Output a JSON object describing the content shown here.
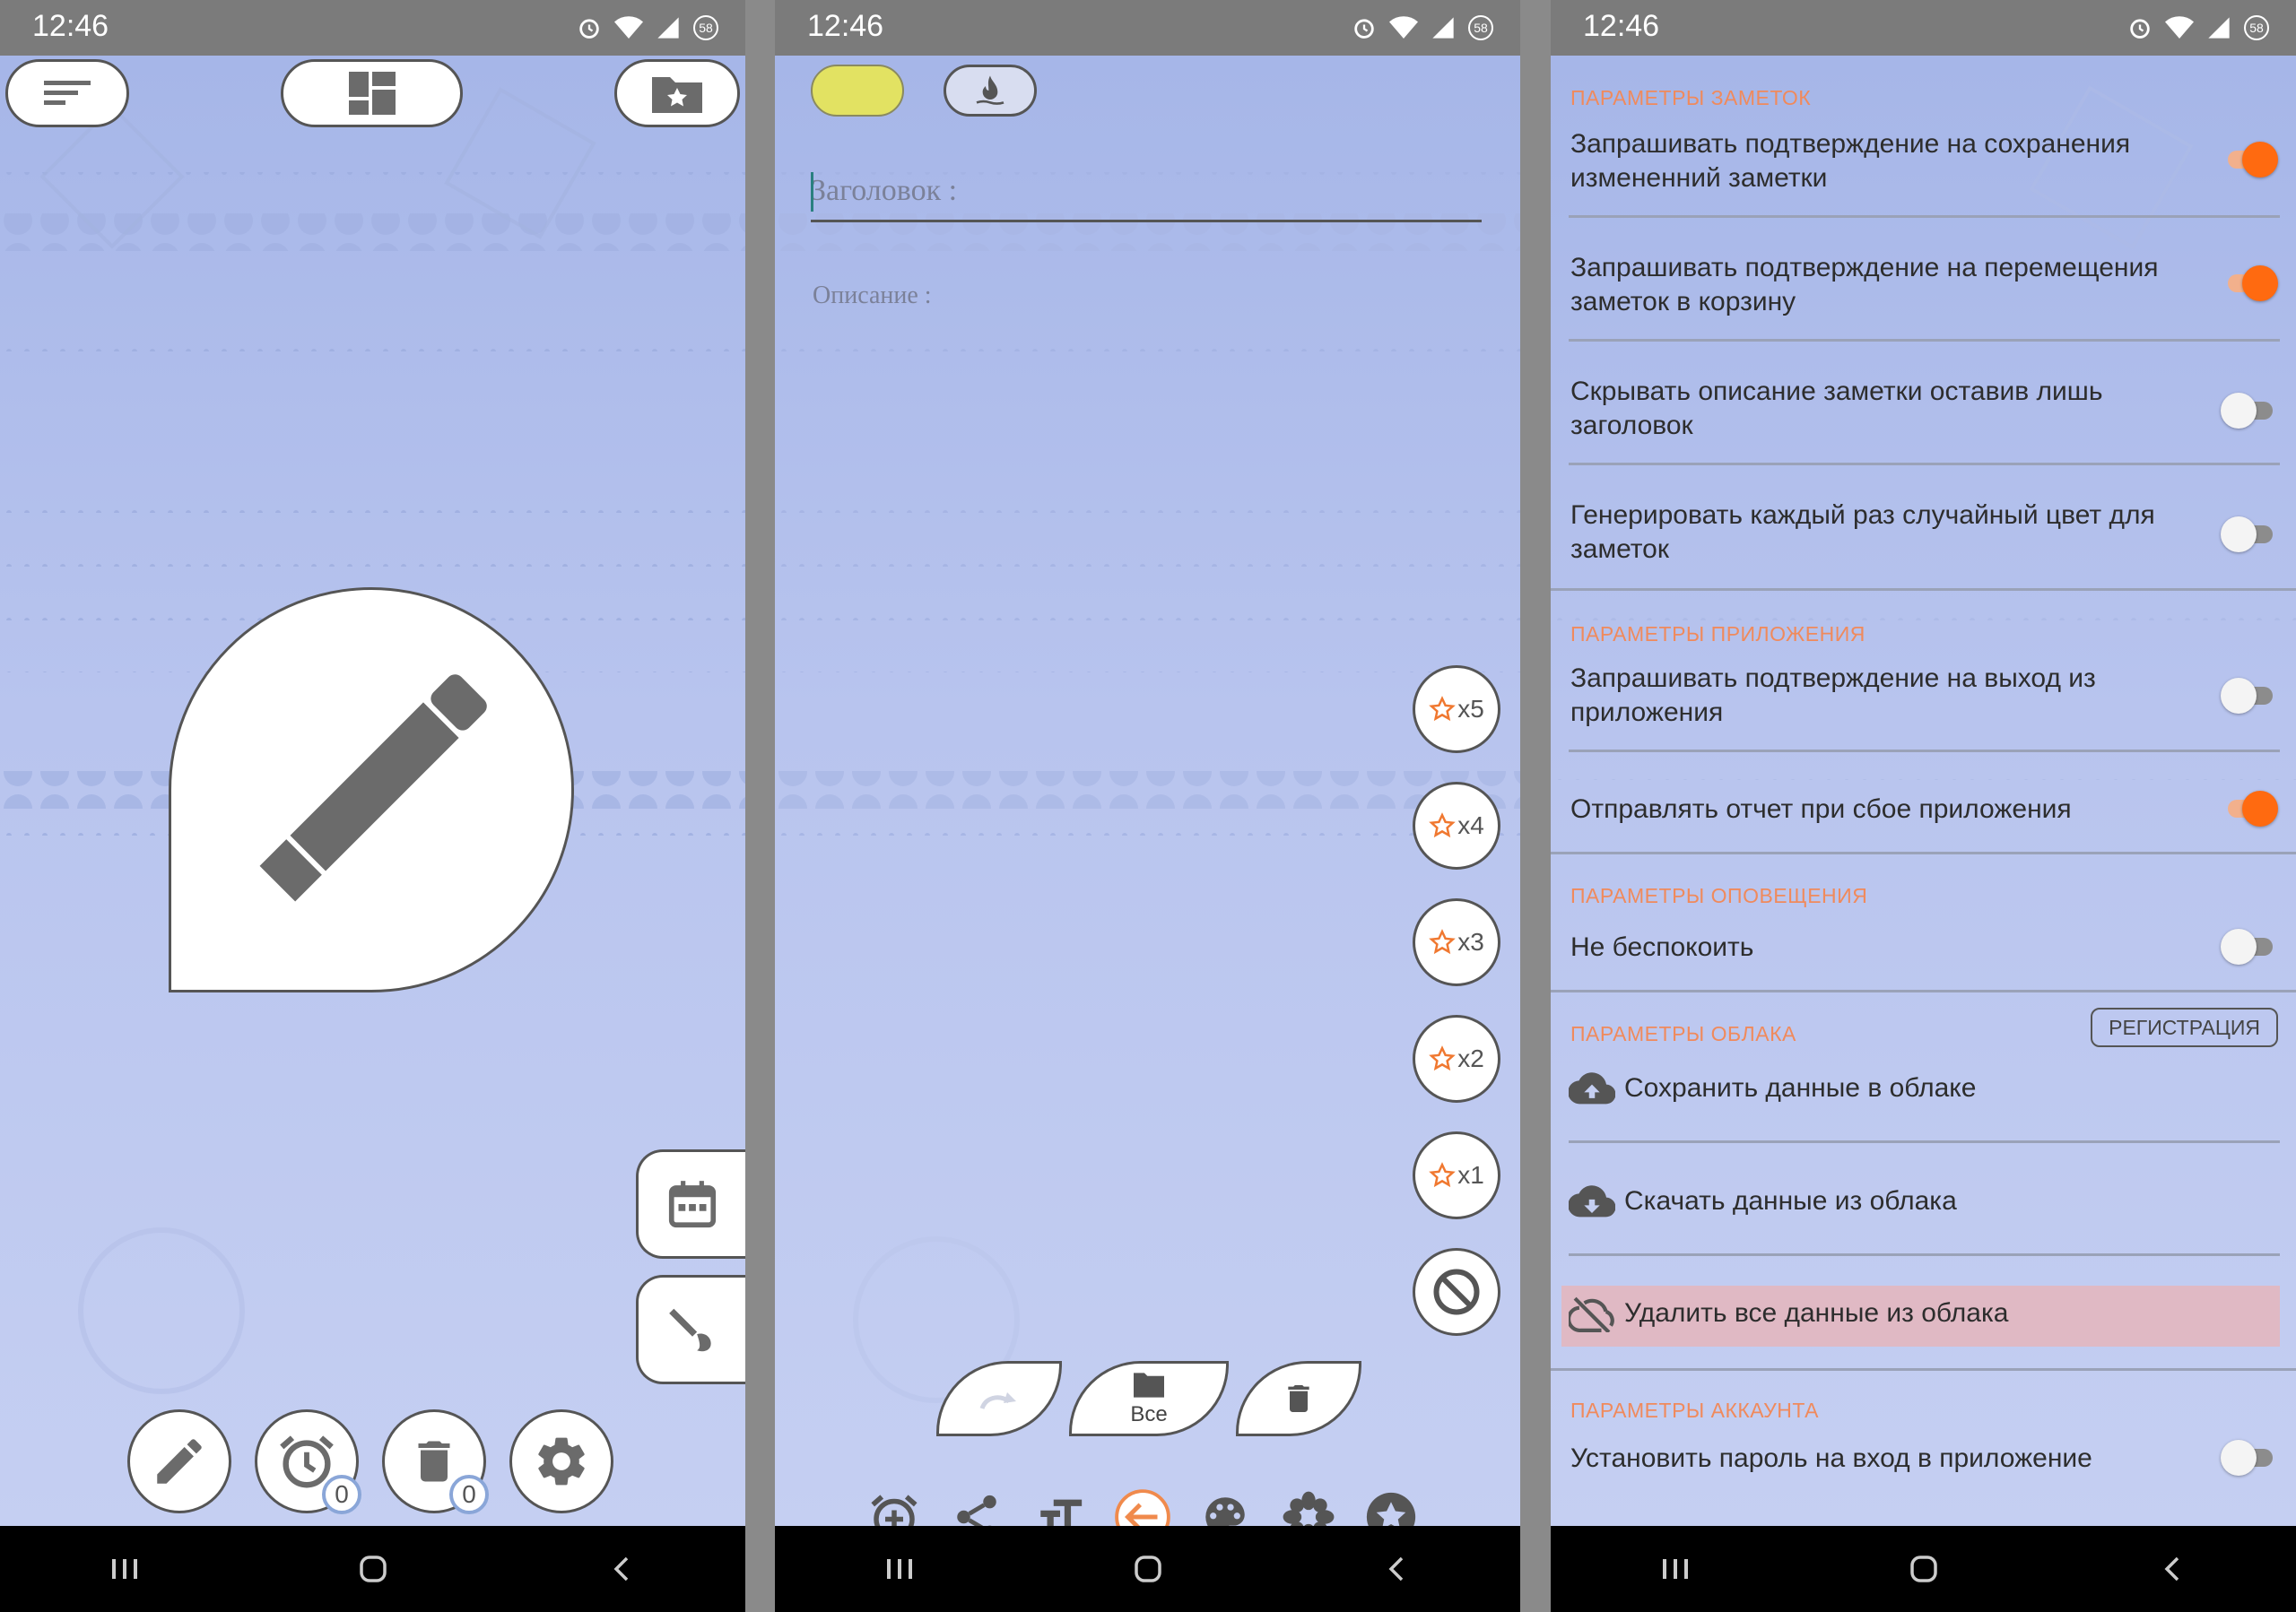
{
  "status": {
    "time": "12:46",
    "notif_count": "58"
  },
  "phone1": {
    "top_buttons": [
      "sort-icon",
      "dashboard-icon",
      "folder-star-icon"
    ],
    "side_buttons": [
      "calendar-icon",
      "brush-icon"
    ],
    "bottom_buttons": [
      {
        "icon": "pencil-icon"
      },
      {
        "icon": "alarm-icon",
        "badge": "0"
      },
      {
        "icon": "trash-icon",
        "badge": "0"
      },
      {
        "icon": "gear-icon"
      }
    ]
  },
  "phone2": {
    "color_swatch": "#e2e262",
    "title_placeholder": "Заголовок :",
    "desc_placeholder": "Описание :",
    "priorities": [
      "x5",
      "x4",
      "x3",
      "x2",
      "x1"
    ],
    "leaf_buttons": {
      "redo": "",
      "all": "Все",
      "delete": ""
    },
    "toolbar": [
      "alarm-add-icon",
      "share-icon",
      "text-size-icon",
      "back-arrow-icon",
      "palette-icon",
      "flower-icon",
      "star-circle-icon"
    ]
  },
  "phone3": {
    "notes_header": "ПАРАМЕТРЫ ЗАМЕТОК",
    "notes": [
      {
        "text": "Запрашивать подтверждение на сохранения измененний заметки",
        "on": true
      },
      {
        "text": "Запрашивать подтверждение на перемещения заметок в корзину",
        "on": true
      },
      {
        "text": "Скрывать описание заметки оставив лишь заголовок",
        "on": false
      },
      {
        "text": "Генерировать каждый раз случайный цвет для заметок",
        "on": false
      }
    ],
    "app_header": "ПАРАМЕТРЫ ПРИЛОЖЕНИЯ",
    "app": [
      {
        "text": "Запрашивать подтверждение на выход из приложения",
        "on": false
      },
      {
        "text": "Отправлять отчет при сбое приложения",
        "on": true
      }
    ],
    "notify_header": "ПАРАМЕТРЫ ОПОВЕЩЕНИЯ",
    "notify": [
      {
        "text": "Не беспокоить",
        "on": false
      }
    ],
    "cloud_header": "ПАРАМЕТРЫ ОБЛАКА",
    "register_label": "РЕГИСТРАЦИЯ",
    "cloud_upload": "Сохранить данные в облаке",
    "cloud_download": "Скачать данные из облака",
    "cloud_delete": "Удалить все данные из облака",
    "account_header": "ПАРАМЕТРЫ АККАУНТА",
    "account": [
      {
        "text": "Установить пароль на вход в приложение",
        "on": false
      }
    ],
    "colors": {
      "accent": "#f08a5c",
      "toggle_on": "#ff6a10",
      "danger_bg": "#e0b9c4"
    }
  }
}
